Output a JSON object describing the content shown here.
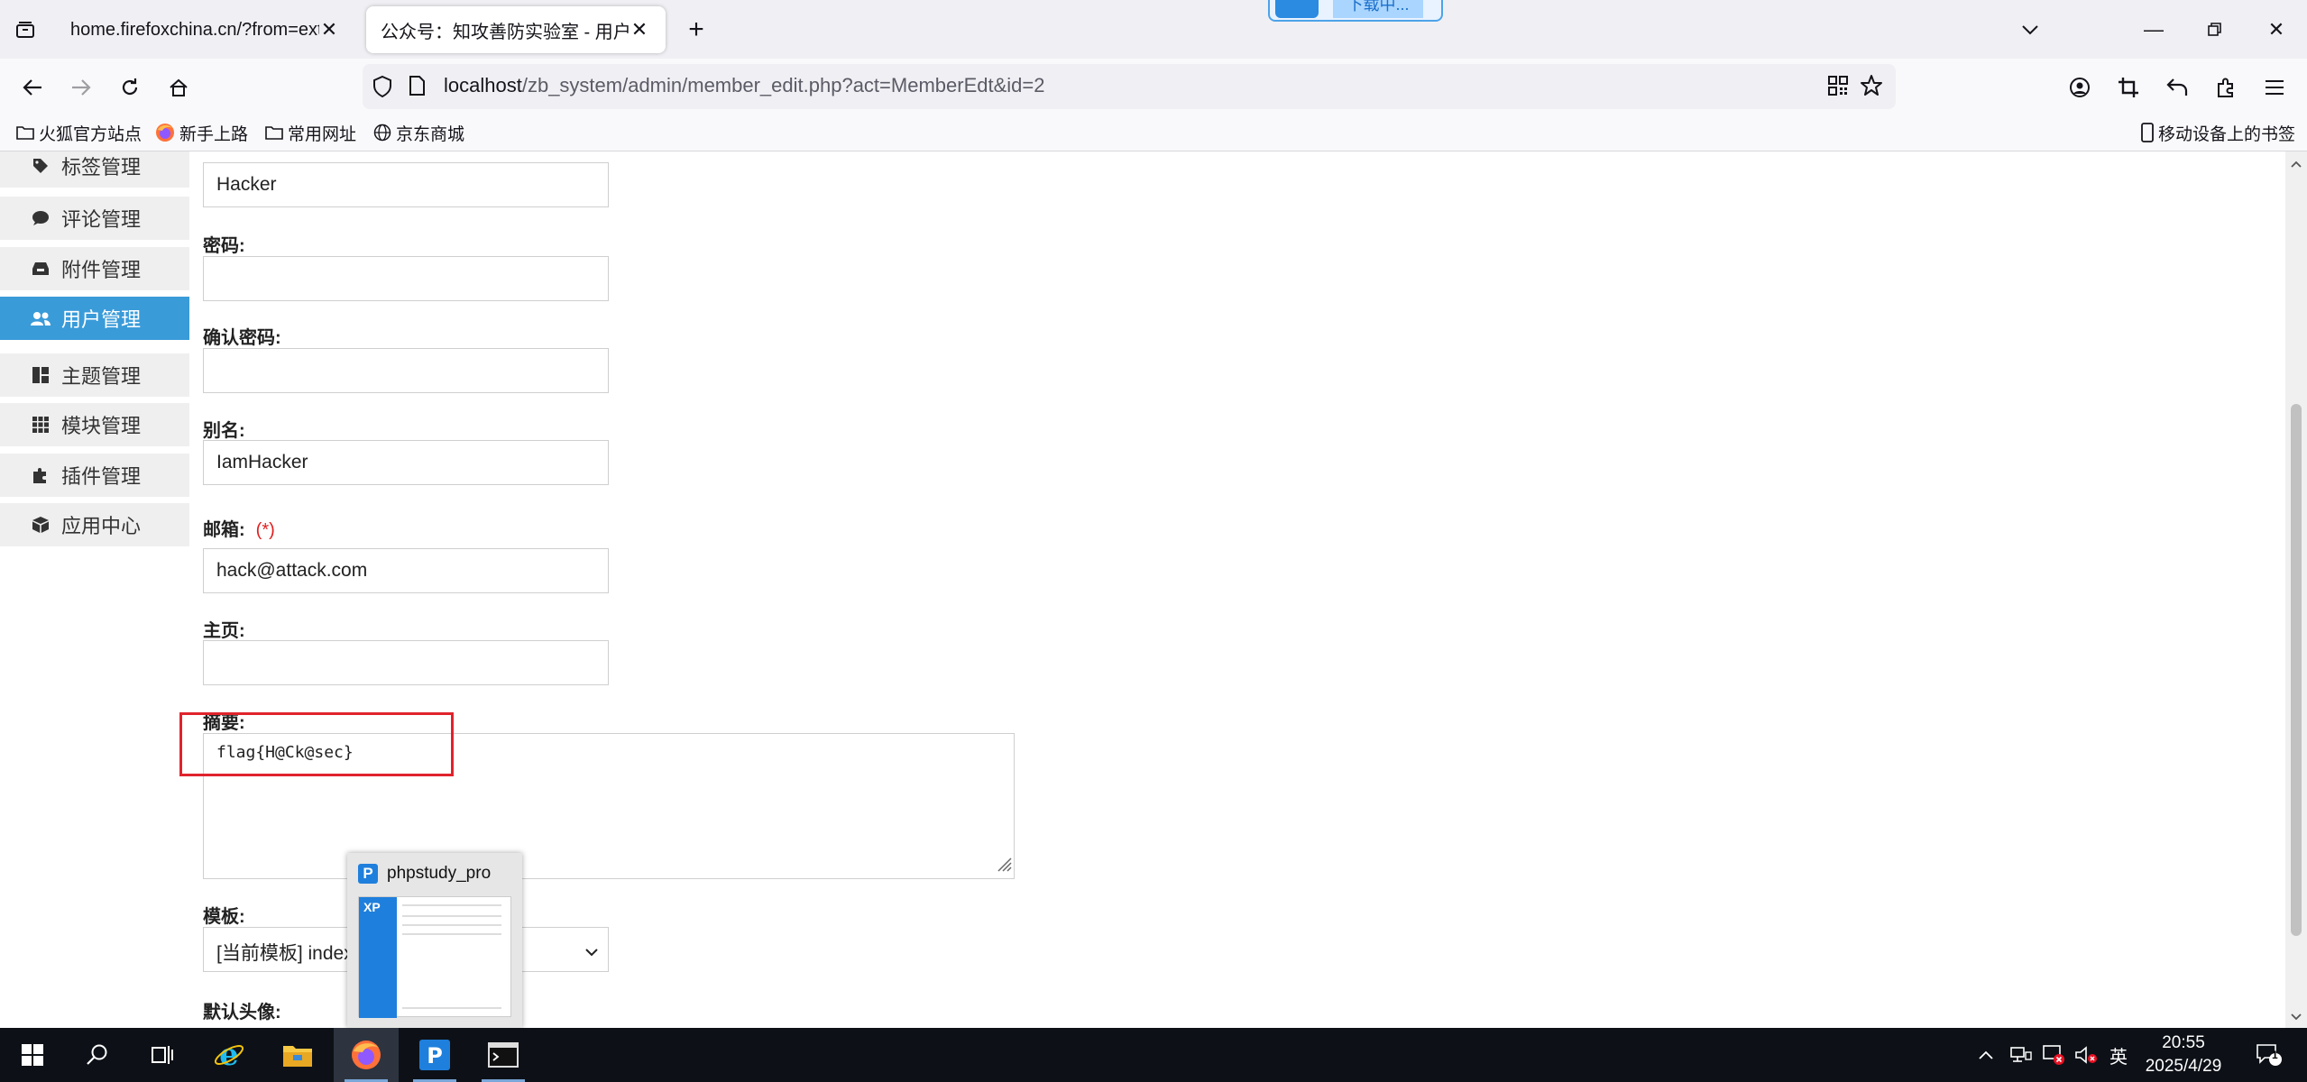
{
  "browser": {
    "tabs": [
      {
        "title": "home.firefoxchina.cn/?from=extra_start",
        "active": false
      },
      {
        "title": "公众号：知攻善防实验室 - 用户编辑",
        "active": true
      }
    ],
    "download_badge": "下载中...",
    "url_host": "localhost",
    "url_path": "/zb_system/admin/member_edit.php?act=MemberEdt&id=2",
    "bookmarks": [
      "火狐官方站点",
      "新手上路",
      "常用网址",
      "京东商城"
    ],
    "mobile_bookmarks": "移动设备上的书签"
  },
  "sidebar": {
    "items": [
      {
        "label": "标签管理",
        "icon": "tag-icon",
        "active": false
      },
      {
        "label": "评论管理",
        "icon": "comment-icon",
        "active": false
      },
      {
        "label": "附件管理",
        "icon": "inbox-icon",
        "active": false
      },
      {
        "label": "用户管理",
        "icon": "users-icon",
        "active": true
      },
      {
        "label": "主题管理",
        "icon": "layout-icon",
        "active": false
      },
      {
        "label": "模块管理",
        "icon": "grid-icon",
        "active": false
      },
      {
        "label": "插件管理",
        "icon": "puzzle-icon",
        "active": false
      },
      {
        "label": "应用中心",
        "icon": "cube-icon",
        "active": false
      }
    ]
  },
  "form": {
    "username_value": "Hacker",
    "password_label": "密码:",
    "password_value": "",
    "confirm_label": "确认密码:",
    "confirm_value": "",
    "alias_label": "别名:",
    "alias_value": "IamHacker",
    "email_label": "邮箱:",
    "required_mark": "(*)",
    "email_value": "hack@attack.com",
    "homepage_label": "主页:",
    "homepage_value": "",
    "intro_label": "摘要:",
    "intro_value": "flag{H@Ck@sec}",
    "template_label": "模板:",
    "template_value": "[当前模板] index",
    "avatar_label": "默认头像:"
  },
  "taskbar_preview": {
    "title": "phpstudy_pro",
    "logo_letter": "P",
    "thumb_logo": "XP"
  },
  "taskbar": {
    "ime": "英",
    "time": "20:55",
    "date": "2025/4/29",
    "notification_count": "1"
  },
  "colors": {
    "accent": "#3a9bd9",
    "required": "#e02020",
    "highlight": "#e0232c",
    "taskbar_bg": "#0d1117"
  }
}
